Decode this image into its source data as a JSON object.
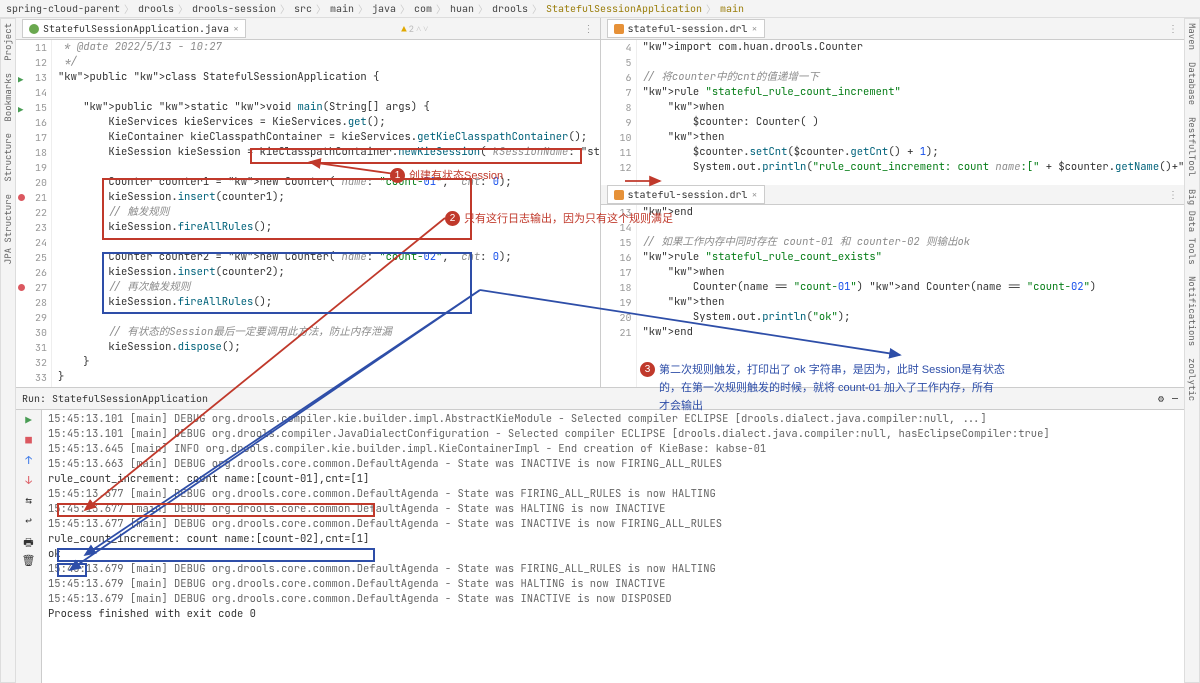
{
  "breadcrumb": [
    "spring-cloud-parent",
    "drools",
    "drools-session",
    "src",
    "main",
    "java",
    "com",
    "huan",
    "drools",
    "StatefulSessionApplication",
    "main"
  ],
  "side_tabs_left": [
    "Project",
    "Bookmarks",
    "Structure",
    "JPA Structure"
  ],
  "side_tabs_right": [
    "Maven",
    "Database",
    "RestfulTool",
    "Big Data Tools",
    "Notifications",
    "zoolytic"
  ],
  "tabs": {
    "left": "StatefulSessionApplication.java",
    "right": "stateful-session.drl",
    "right2": "stateful-session.drl"
  },
  "warn_count": "2",
  "gutter_left_start": 11,
  "gutter_right_start": 4,
  "java_lines": [
    {
      "t": " * @date 2022/5/13 - 10:27",
      "cls": "cmt"
    },
    {
      "t": " */",
      "cls": "cmt"
    },
    {
      "t": "public class StatefulSessionApplication {",
      "cls": ""
    },
    {
      "t": "",
      "cls": ""
    },
    {
      "t": "    public static void main(String[] args) {",
      "cls": ""
    },
    {
      "t": "        KieServices kieServices = KieServices.get();",
      "cls": ""
    },
    {
      "t": "        KieContainer kieClasspathContainer = kieServices.getKieClasspathContainer();",
      "cls": ""
    },
    {
      "t": "        KieSession kieSession = kieClasspathContainer.newKieSession( kSessionName: \"stateful-",
      "cls": ""
    },
    {
      "t": "",
      "cls": ""
    },
    {
      "t": "        Counter counter1 = new Counter( name: \"count-01\",  cnt: 0);",
      "cls": ""
    },
    {
      "t": "        kieSession.insert(counter1);",
      "cls": ""
    },
    {
      "t": "        // 触发规则",
      "cls": "cmt"
    },
    {
      "t": "        kieSession.fireAllRules();",
      "cls": ""
    },
    {
      "t": "",
      "cls": ""
    },
    {
      "t": "        Counter counter2 = new Counter( name: \"count-02\",  cnt: 0);",
      "cls": ""
    },
    {
      "t": "        kieSession.insert(counter2);",
      "cls": ""
    },
    {
      "t": "        // 再次触发规则",
      "cls": "cmt"
    },
    {
      "t": "        kieSession.fireAllRules();",
      "cls": ""
    },
    {
      "t": "",
      "cls": ""
    },
    {
      "t": "        // 有状态的Session最后一定要调用此方法，防止内存泄漏",
      "cls": "cmt"
    },
    {
      "t": "        kieSession.dispose();",
      "cls": ""
    },
    {
      "t": "    }",
      "cls": ""
    },
    {
      "t": "}",
      "cls": ""
    },
    {
      "t": "",
      "cls": ""
    }
  ],
  "drl_lines_a": [
    {
      "t": "import com.huan.drools.Counter",
      "cls": ""
    },
    {
      "t": "",
      "cls": ""
    },
    {
      "t": "// 将counter中的cnt的值递增一下",
      "cls": "cmt"
    },
    {
      "t": "rule \"stateful_rule_count_increment\"",
      "cls": ""
    },
    {
      "t": "    when",
      "cls": ""
    },
    {
      "t": "        $counter: Counter( )",
      "cls": ""
    },
    {
      "t": "    then",
      "cls": ""
    },
    {
      "t": "        $counter.setCnt($counter.getCnt() + 1);",
      "cls": ""
    },
    {
      "t": "        System.out.println(\"rule_count_increment: count name:[\" + $counter.getName()+\"],cnt=",
      "cls": ""
    }
  ],
  "drl_lines_b": [
    {
      "t": "end",
      "cls": ""
    },
    {
      "t": "",
      "cls": ""
    },
    {
      "t": "// 如果工作内存中同时存在 count-01 和 counter-02 则输出ok",
      "cls": "cmt"
    },
    {
      "t": "rule \"stateful_rule_count_exists\"",
      "cls": ""
    },
    {
      "t": "    when",
      "cls": ""
    },
    {
      "t": "        Counter(name == \"count-01\") and Counter(name == \"count-02\")",
      "cls": ""
    },
    {
      "t": "    then",
      "cls": ""
    },
    {
      "t": "        System.out.println(\"ok\");",
      "cls": ""
    },
    {
      "t": "end",
      "cls": ""
    }
  ],
  "run_config": "StatefulSessionApplication",
  "run_label": "Run:",
  "console_lines": [
    "15:45:13.101 [main] DEBUG org.drools.compiler.kie.builder.impl.AbstractKieModule - Selected compiler ECLIPSE [drools.dialect.java.compiler:null, ...]",
    "15:45:13.101 [main] DEBUG org.drools.compiler.JavaDialectConfiguration - Selected compiler ECLIPSE [drools.dialect.java.compiler:null, hasEclipseCompiler:true]",
    "15:45:13.645 [main] INFO org.drools.compiler.kie.builder.impl.KieContainerImpl - End creation of KieBase: kabse-01",
    "15:45:13.663 [main] DEBUG org.drools.core.common.DefaultAgenda - State was INACTIVE is now FIRING_ALL_RULES",
    "rule_count_increment: count name:[count-01],cnt=[1]",
    "15:45:13.677 [main] DEBUG org.drools.core.common.DefaultAgenda - State was FIRING_ALL_RULES is now HALTING",
    "15:45:13.677 [main] DEBUG org.drools.core.common.DefaultAgenda - State was HALTING is now INACTIVE",
    "15:45:13.677 [main] DEBUG org.drools.core.common.DefaultAgenda - State was INACTIVE is now FIRING_ALL_RULES",
    "rule_count_increment: count name:[count-02],cnt=[1]",
    "ok",
    "15:45:13.679 [main] DEBUG org.drools.core.common.DefaultAgenda - State was FIRING_ALL_RULES is now HALTING",
    "15:45:13.679 [main] DEBUG org.drools.core.common.DefaultAgenda - State was HALTING is now INACTIVE",
    "15:45:13.679 [main] DEBUG org.drools.core.common.DefaultAgenda - State was INACTIVE is now DISPOSED",
    "",
    "Process finished with exit code 0"
  ],
  "callouts": {
    "c1": "创建有状态Session",
    "c2": "只有这行日志输出，因为只有这个规则满足",
    "c3a": "第二次规则触发，打印出了 ok 字符串，是因为，此时 Session是有状态",
    "c3b": "的，在第一次规则触发的时候，就将 count-01 加入了工作内存，所有",
    "c3c": "才会输出"
  }
}
